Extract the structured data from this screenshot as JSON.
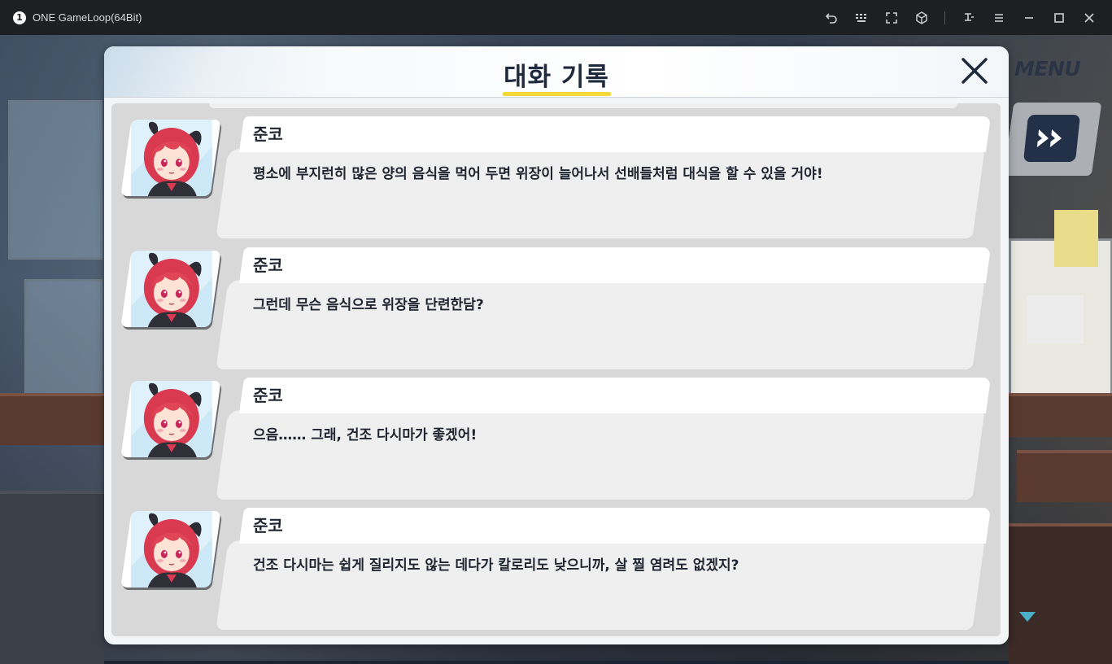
{
  "window": {
    "badge": "1",
    "title": "ONE GameLoop(64Bit)"
  },
  "hud": {
    "menu_label": "MENU"
  },
  "dialog_log": {
    "title": "대화 기록",
    "entries": [
      {
        "speaker": "준코",
        "line": "평소에 부지런히 많은 양의 음식을 먹어 두면 위장이 늘어나서 선배들처럼 대식을 할 수 있을 거야!"
      },
      {
        "speaker": "준코",
        "line": "그런데 무슨 음식으로 위장을 단련한담?"
      },
      {
        "speaker": "준코",
        "line": "으음…… 그래, 건조 다시마가 좋겠어!"
      },
      {
        "speaker": "준코",
        "line": "건조 다시마는 쉽게 질리지도 않는 데다가 칼로리도 낮으니까, 살 찔 염려도 없겠지?"
      }
    ]
  },
  "colors": {
    "accent_underline": "#f3d93a",
    "title_text": "#1f2b3d",
    "scroll_indicator": "#4ab0c8"
  }
}
